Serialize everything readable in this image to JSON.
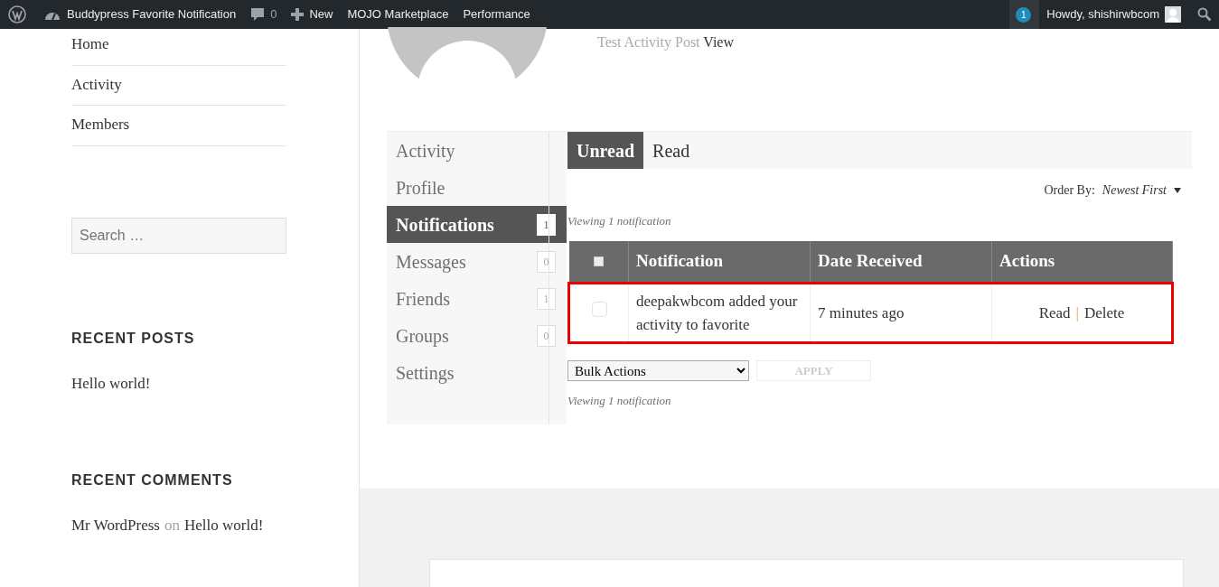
{
  "admin_bar": {
    "left_items": [
      {
        "kind": "logo"
      },
      {
        "kind": "site",
        "label": "Buddypress Favorite Notification"
      },
      {
        "kind": "comments",
        "label": "0"
      },
      {
        "kind": "new",
        "label": "New"
      },
      {
        "kind": "text",
        "label": "MOJO Marketplace"
      },
      {
        "kind": "text",
        "label": "Performance"
      }
    ],
    "notification_count": "1",
    "greeting": "Howdy, shishirwbcom"
  },
  "sidebar": {
    "nav": [
      "Home",
      "Activity",
      "Members"
    ],
    "search": {
      "placeholder": "Search …"
    },
    "recent_posts": {
      "title": "RECENT POSTS",
      "items": [
        "Hello world!"
      ]
    },
    "recent_comments": {
      "title": "RECENT COMMENTS",
      "items": [
        {
          "author": "Mr WordPress",
          "connector": "on",
          "post": "Hello world!"
        }
      ]
    }
  },
  "profile": {
    "activity_text": "Test Activity Post",
    "activity_link": "View"
  },
  "subnav": [
    {
      "label": "Activity",
      "selected": false
    },
    {
      "label": "Profile",
      "selected": false
    },
    {
      "label": "Notifications",
      "count": "1",
      "selected": true
    },
    {
      "label": "Messages",
      "count": "0",
      "selected": false
    },
    {
      "label": "Friends",
      "count": "1",
      "selected": false
    },
    {
      "label": "Groups",
      "count": "0",
      "selected": false
    },
    {
      "label": "Settings",
      "selected": false
    }
  ],
  "tabs": [
    {
      "label": "Unread",
      "selected": true
    },
    {
      "label": "Read",
      "selected": false
    }
  ],
  "order_by": {
    "label": "Order By:",
    "value": "Newest First"
  },
  "viewing_top": "Viewing 1 notification",
  "table": {
    "header_checked": false,
    "columns": [
      "Notification",
      "Date Received",
      "Actions"
    ],
    "rows": [
      {
        "checked": false,
        "highlighted": true,
        "notification": "deepakwbcom added your activity to favorite",
        "date": "7 minutes ago",
        "actions": [
          "Read",
          "Delete"
        ],
        "separator": "|"
      }
    ]
  },
  "bulk": {
    "select": "Bulk Actions",
    "apply": "APPLY",
    "apply_disabled": true
  },
  "viewing_bottom": "Viewing 1 notification"
}
